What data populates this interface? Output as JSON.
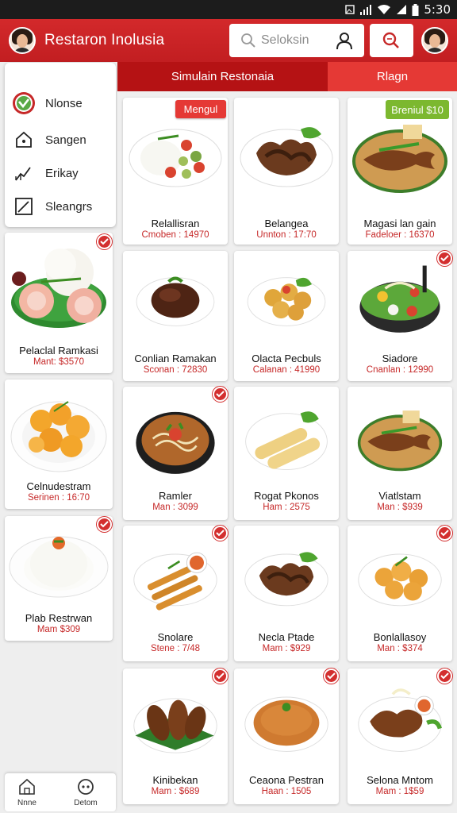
{
  "status_bar": {
    "time": "5:30"
  },
  "header": {
    "title": "Restaron Inolusia",
    "search_placeholder": "Seloksin"
  },
  "sidebar": {
    "nav": [
      {
        "label": "Nlonse",
        "icon": "home-check-icon"
      },
      {
        "label": "Sangen",
        "icon": "house-icon"
      },
      {
        "label": "Erikay",
        "icon": "chart-line-icon"
      },
      {
        "label": "Sleangrs",
        "icon": "trend-box-icon"
      }
    ],
    "cards": [
      {
        "name": "Pelaclal Ramkasi",
        "price": "Mant: $3570",
        "checked": true
      },
      {
        "name": "Celnudestram",
        "price": "Serinen : 16:70",
        "checked": false
      },
      {
        "name": "Plab Restrwan",
        "price": "Mam $309",
        "checked": true
      }
    ]
  },
  "bottom_nav": [
    {
      "label": "Nnne",
      "icon": "home-icon"
    },
    {
      "label": "Detom",
      "icon": "chat-icon"
    }
  ],
  "tabs": [
    {
      "label": "Simulain Restonaia",
      "active": true
    },
    {
      "label": "Rlagn",
      "active": false
    }
  ],
  "badges": {
    "red": "Mengul",
    "green": "Breniul $10"
  },
  "menu": [
    {
      "name": "Relallisran",
      "price": "Cmoben : 14970",
      "checked": false,
      "dish": "rice-veg"
    },
    {
      "name": "Belangea",
      "price": "Unnton : 17:70",
      "checked": false,
      "dish": "wings"
    },
    {
      "name": "Magasi lan gain",
      "price": "Fadeloer : 16370",
      "checked": false,
      "dish": "fish"
    },
    {
      "name": "Conlian Ramakan",
      "price": "Sconan : 72830",
      "checked": false,
      "dish": "beef"
    },
    {
      "name": "Olacta Pecbuls",
      "price": "Calanan : 41990",
      "checked": false,
      "dish": "fritters"
    },
    {
      "name": "Siadore",
      "price": "Cnanlan : 12990",
      "checked": true,
      "dish": "salad"
    },
    {
      "name": "Ramler",
      "price": "Man : 3099",
      "checked": true,
      "dish": "noodle"
    },
    {
      "name": "Rogat Pkonos",
      "price": "Ham : 2575",
      "checked": false,
      "dish": "rolls"
    },
    {
      "name": "Viatlstam",
      "price": "Man : $939",
      "checked": false,
      "dish": "fish"
    },
    {
      "name": "Snolare",
      "price": "Stene : 7/48",
      "checked": true,
      "dish": "sticks"
    },
    {
      "name": "Necla Ptade",
      "price": "Mam : $929",
      "checked": false,
      "dish": "wings"
    },
    {
      "name": "Bonlallasoy",
      "price": "Man : $374",
      "checked": true,
      "dish": "fried"
    },
    {
      "name": "Kinibekan",
      "price": "Mam : $689",
      "checked": true,
      "dish": "drums"
    },
    {
      "name": "Ceaona Pestran",
      "price": "Haan : 1505",
      "checked": true,
      "dish": "friedrice"
    },
    {
      "name": "Selona Mntom",
      "price": "Mam : 1$59",
      "checked": true,
      "dish": "chicken-sauce"
    }
  ]
}
